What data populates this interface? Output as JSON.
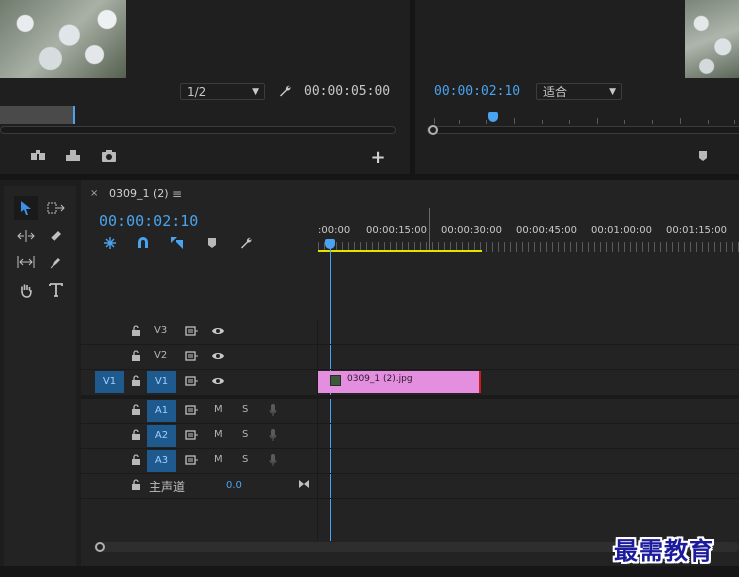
{
  "source_monitor": {
    "zoom_select": "1/2",
    "duration": "00:00:05:00"
  },
  "program_monitor": {
    "timecode": "00:00:02:10",
    "fit_select": "适合"
  },
  "sequence": {
    "tab_title": "0309_1 (2)",
    "timecode": "00:00:02:10",
    "ruler_labels": [
      ":00:00",
      "00:00:15:00",
      "00:00:30:00",
      "00:00:45:00",
      "00:01:00:00",
      "00:01:15:00"
    ]
  },
  "tracks": {
    "v3": {
      "name": "V3"
    },
    "v2": {
      "name": "V2"
    },
    "v1": {
      "name": "V1",
      "source": "V1"
    },
    "a1": {
      "name": "A1",
      "mute": "M",
      "solo": "S"
    },
    "a2": {
      "name": "A2",
      "mute": "M",
      "solo": "S"
    },
    "a3": {
      "name": "A3",
      "mute": "M",
      "solo": "S"
    },
    "master": {
      "name": "主声道",
      "value": "0.0"
    }
  },
  "clip": {
    "name": "0309_1 (2).jpg",
    "color": "#e48ee0"
  },
  "watermark": "最需教育",
  "colors": {
    "accent_blue": "#4aa3f0",
    "work_area": "#e5e200",
    "clip_pink": "#e48ee0"
  }
}
